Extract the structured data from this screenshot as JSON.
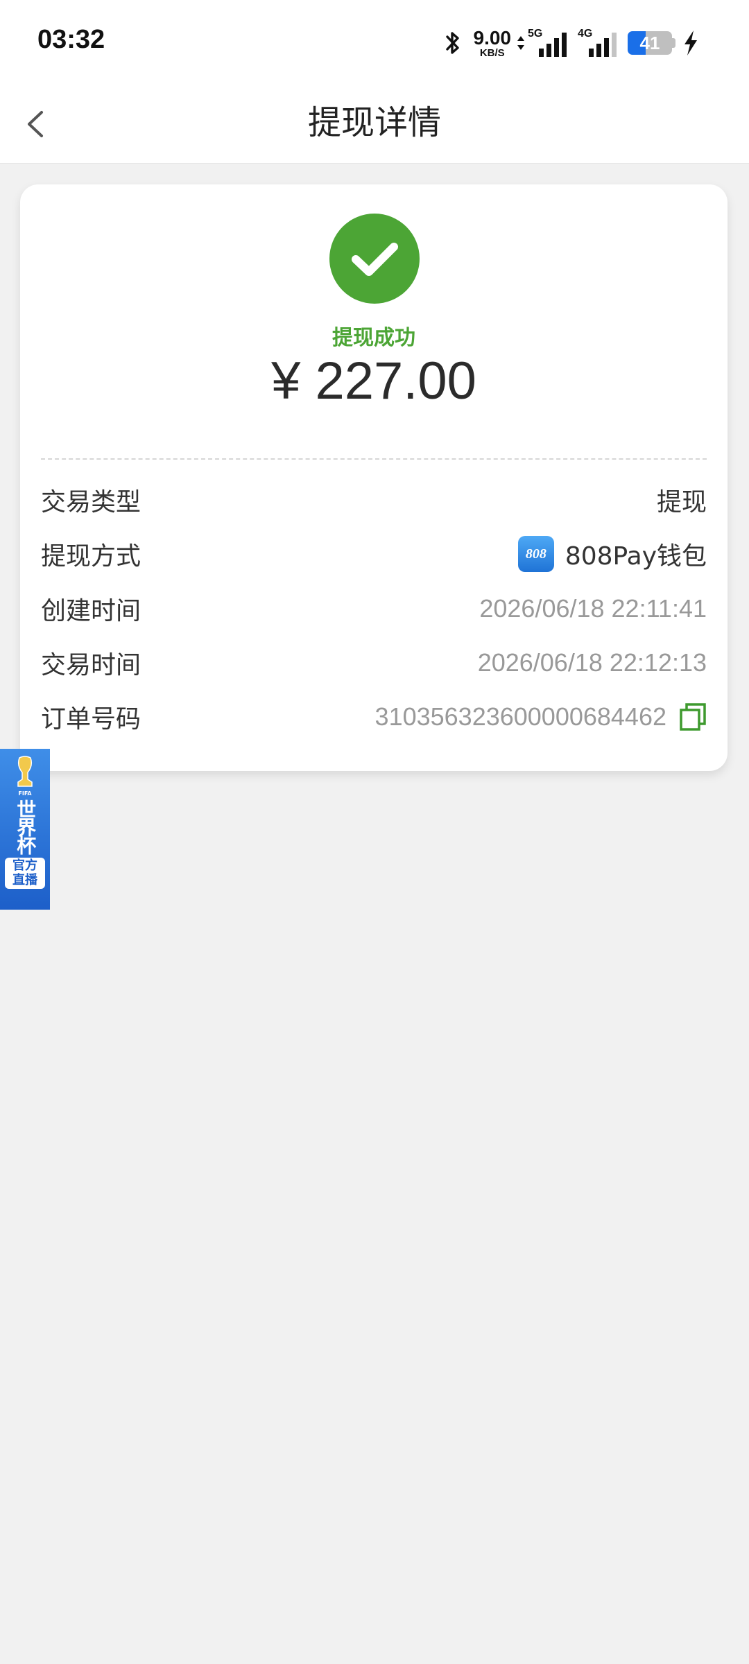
{
  "status_bar": {
    "time": "03:32",
    "net_speed": "9.00",
    "net_unit": "KB/S",
    "sim1_label": "5G",
    "sim2_label": "4G",
    "battery": "41",
    "icons": [
      "bluetooth-icon",
      "data-arrows-icon",
      "signal-icon",
      "battery-icon",
      "charging-icon"
    ]
  },
  "header": {
    "title": "提现详情",
    "back_icon": "chevron-left-icon"
  },
  "result": {
    "status": "提现成功",
    "amount": "¥ 227.00",
    "status_color": "#4ca535"
  },
  "details": {
    "type_label": "交易类型",
    "type_value": "提现",
    "method_label": "提现方式",
    "method_logo_text": "808",
    "method_value": "808Pay钱包",
    "created_label": "创建时间",
    "created_value": "2026/06/18 22:11:41",
    "trade_time_label": "交易时间",
    "trade_time_value": "2026/06/18 22:12:13",
    "order_label": "订单号码",
    "order_value": "310356323600000684462"
  },
  "banner": {
    "fifa": "FIFA",
    "big": "世界杯",
    "small_1": "官方",
    "small_2": "直播"
  }
}
